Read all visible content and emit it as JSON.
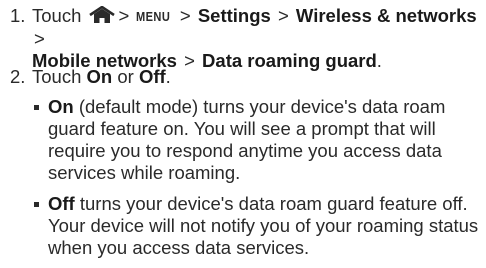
{
  "step1": {
    "number": "1.",
    "lead": "Touch",
    "home_icon": "home-icon",
    "menu_key": "MENU",
    "separator": ">",
    "path": [
      "Settings",
      "Wireless & networks",
      "Mobile networks",
      "Data roaming guard"
    ],
    "end": "."
  },
  "step2": {
    "number": "2.",
    "lead": "Touch",
    "on": "On",
    "or": "or",
    "off": "Off",
    "end": "."
  },
  "bullets": [
    {
      "term": "On",
      "text": "(default mode) turns your device's data roam guard feature on. You will see a prompt that will require you to respond anytime you access data services while roaming."
    },
    {
      "term": "Off",
      "text": "turns your device's data roam guard feature off. Your device will not notify you of your roaming status when you access data services."
    }
  ]
}
